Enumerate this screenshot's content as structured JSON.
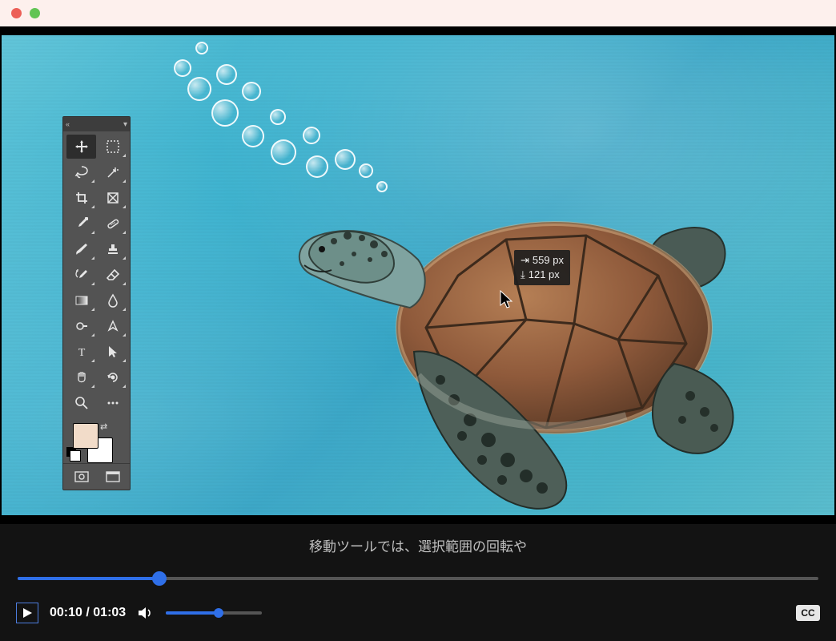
{
  "window": {
    "traffic_red": "#ec5f57",
    "traffic_green": "#61c454"
  },
  "toolbox": {
    "tools": [
      {
        "name": "move-tool",
        "selected": true,
        "corner": false
      },
      {
        "name": "marquee-tool",
        "selected": false,
        "corner": true
      },
      {
        "name": "lasso-tool",
        "selected": false,
        "corner": true
      },
      {
        "name": "magic-wand-tool",
        "selected": false,
        "corner": true
      },
      {
        "name": "crop-tool",
        "selected": false,
        "corner": true
      },
      {
        "name": "perspective-crop-tool",
        "selected": false,
        "corner": true
      },
      {
        "name": "eyedropper-tool",
        "selected": false,
        "corner": true
      },
      {
        "name": "spot-healing-brush-tool",
        "selected": false,
        "corner": true
      },
      {
        "name": "brush-tool",
        "selected": false,
        "corner": true
      },
      {
        "name": "clone-stamp-tool",
        "selected": false,
        "corner": true
      },
      {
        "name": "history-brush-tool",
        "selected": false,
        "corner": true
      },
      {
        "name": "eraser-tool",
        "selected": false,
        "corner": true
      },
      {
        "name": "gradient-tool",
        "selected": false,
        "corner": true
      },
      {
        "name": "blur-tool",
        "selected": false,
        "corner": true
      },
      {
        "name": "dodge-tool",
        "selected": false,
        "corner": true
      },
      {
        "name": "pen-tool",
        "selected": false,
        "corner": true
      },
      {
        "name": "type-tool",
        "selected": false,
        "corner": true
      },
      {
        "name": "path-selection-tool",
        "selected": false,
        "corner": true
      },
      {
        "name": "hand-tool",
        "selected": false,
        "corner": true
      },
      {
        "name": "rotate-view-tool",
        "selected": false,
        "corner": true
      },
      {
        "name": "zoom-tool",
        "selected": false,
        "corner": false
      },
      {
        "name": "more-tools",
        "selected": false,
        "corner": false
      }
    ],
    "swatches": {
      "fg": "#f2dcc9",
      "bg": "#ffffff"
    },
    "quick_mask_label": "⬚"
  },
  "overlay": {
    "x_label": "559 px",
    "y_label": "121 px"
  },
  "caption": "移動ツールでは、選択範囲の回転や",
  "player": {
    "current_time": "00:10",
    "duration": "01:03",
    "separator": " / ",
    "progress_fraction": 0.177,
    "volume_fraction": 0.55,
    "cc_label": "CC"
  }
}
